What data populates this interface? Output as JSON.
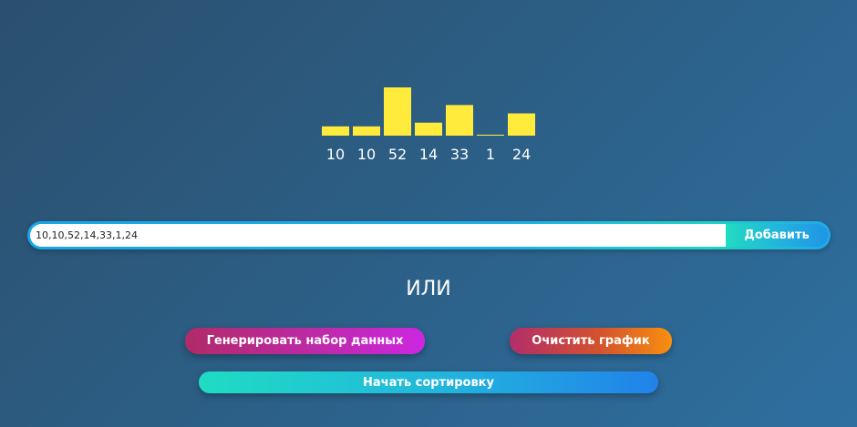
{
  "chart_data": {
    "type": "bar",
    "categories": [
      "10",
      "10",
      "52",
      "14",
      "33",
      "1",
      "24"
    ],
    "values": [
      10,
      10,
      52,
      14,
      33,
      1,
      24
    ],
    "title": "",
    "xlabel": "",
    "ylabel": "",
    "ylim": [
      0,
      52
    ],
    "grid": false,
    "bar_color": "#ffeb3b"
  },
  "input": {
    "value": "10,10,52,14,33,1,24",
    "placeholder": ""
  },
  "buttons": {
    "add_label": "Добавить",
    "generate_label": "Генерировать набор данных",
    "clear_label": "Очистить график",
    "sort_label": "Начать сортировку"
  },
  "or_text": "ИЛИ"
}
